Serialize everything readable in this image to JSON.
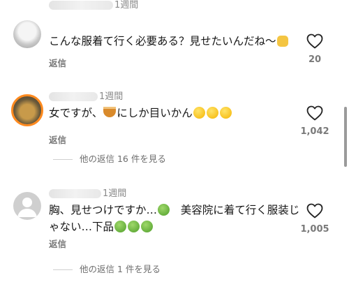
{
  "comments": [
    {
      "time": "1週間",
      "text": "こんな服着て行く必要ある？見せたいんだね〜",
      "emojis_after": [
        "clapping-hands"
      ],
      "reply_label": "返信",
      "likes": "20"
    },
    {
      "time": "1週間",
      "text_part1": "女ですが、",
      "text_part2": "にしか目いかん",
      "emojis_mid": [
        "bowl"
      ],
      "emojis_after": [
        "rofl",
        "rofl",
        "rofl"
      ],
      "reply_label": "返信",
      "likes": "1,042",
      "more_replies": "他の返信 16 件を見る"
    },
    {
      "time": "1週間",
      "line1_part1": "胸、見せつけですか…",
      "line1_part2": "美容院に着て行く服装じ",
      "line2": "ゃない…下品",
      "reply_label": "返信",
      "likes": "1,005",
      "more_replies": "他の返信 1 件を見る"
    }
  ]
}
